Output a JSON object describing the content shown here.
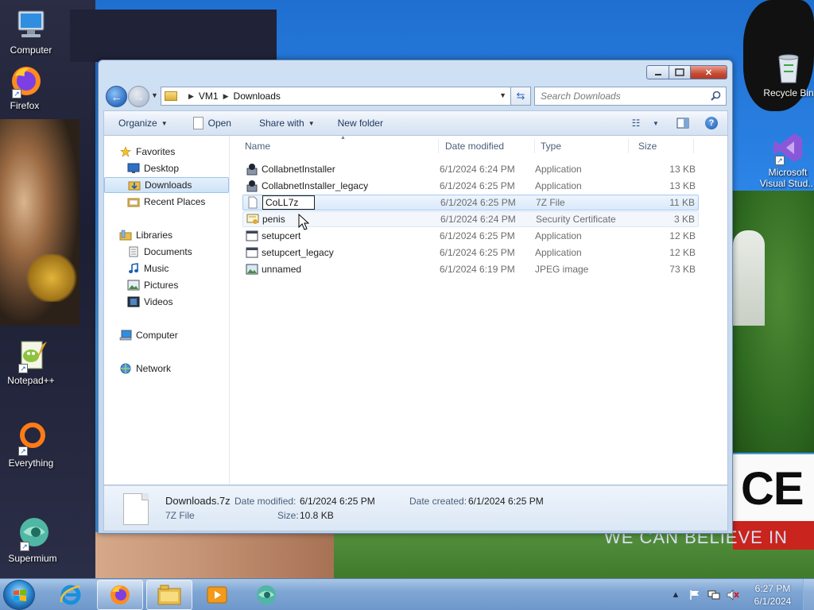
{
  "desktop": {
    "icons": [
      {
        "name": "Computer"
      },
      {
        "name": "Firefox"
      },
      {
        "name": "Notepad++"
      },
      {
        "name": "Everything"
      },
      {
        "name": "Supermium"
      },
      {
        "name": "Recycle Bin"
      },
      {
        "name": "Microsoft Visual Stud..."
      }
    ],
    "wallpaper_text": {
      "sign": "CE",
      "sign_sub": "WE CAN BELIEVE IN"
    }
  },
  "window": {
    "breadcrumb": [
      "VM1",
      "Downloads"
    ],
    "search_placeholder": "Search Downloads",
    "toolbar": {
      "organize": "Organize",
      "open": "Open",
      "share_with": "Share with",
      "new_folder": "New folder"
    },
    "nav_pane": {
      "favorites": "Favorites",
      "desktop": "Desktop",
      "downloads": "Downloads",
      "recent_places": "Recent Places",
      "libraries": "Libraries",
      "documents": "Documents",
      "music": "Music",
      "pictures": "Pictures",
      "videos": "Videos",
      "computer": "Computer",
      "network": "Network"
    },
    "columns": {
      "name": "Name",
      "date": "Date modified",
      "type": "Type",
      "size": "Size"
    },
    "files": [
      {
        "name": "CollabnetInstaller",
        "date": "6/1/2024 6:24 PM",
        "type": "Application",
        "size": "13 KB",
        "icon": "installer-icon"
      },
      {
        "name": "CollabnetInstaller_legacy",
        "date": "6/1/2024 6:25 PM",
        "type": "Application",
        "size": "13 KB",
        "icon": "installer-icon"
      },
      {
        "name": "CoLL7z",
        "date": "6/1/2024 6:25 PM",
        "type": "7Z File",
        "size": "11 KB",
        "icon": "blank-file-icon",
        "renaming": true
      },
      {
        "name": "penis",
        "date": "6/1/2024 6:24 PM",
        "type": "Security Certificate",
        "size": "3 KB",
        "icon": "certificate-icon"
      },
      {
        "name": "setupcert",
        "date": "6/1/2024 6:25 PM",
        "type": "Application",
        "size": "12 KB",
        "icon": "app-window-icon"
      },
      {
        "name": "setupcert_legacy",
        "date": "6/1/2024 6:25 PM",
        "type": "Application",
        "size": "12 KB",
        "icon": "app-window-icon"
      },
      {
        "name": "unnamed",
        "date": "6/1/2024 6:19 PM",
        "type": "JPEG image",
        "size": "73 KB",
        "icon": "image-file-icon"
      }
    ],
    "details": {
      "name": "Downloads.7z",
      "type": "7Z File",
      "date_modified_label": "Date modified:",
      "date_modified": "6/1/2024 6:25 PM",
      "size_label": "Size:",
      "size": "10.8 KB",
      "date_created_label": "Date created:",
      "date_created": "6/1/2024 6:25 PM"
    }
  },
  "taskbar": {
    "apps": [
      "internet-explorer-icon",
      "firefox-icon",
      "explorer-icon",
      "media-player-icon",
      "supermium-icon"
    ],
    "clock_time": "6:27 PM",
    "clock_date": "6/1/2024"
  },
  "colors": {
    "accent": "#2d6ec1",
    "selection": "#cde3f8",
    "taskbar": "#7fa6d4"
  }
}
